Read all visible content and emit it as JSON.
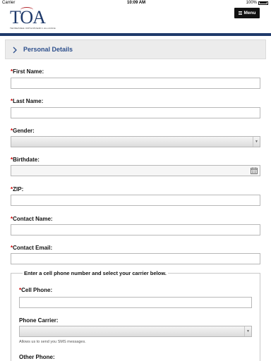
{
  "status_bar": {
    "carrier": "Carrier",
    "time": "10:09 AM",
    "battery": "100%"
  },
  "header": {
    "logo_text": "TOA",
    "logo_tagline": "TENNESSEE ORTHOPAEDIC ALLIANCE",
    "menu_label": "Menu"
  },
  "section": {
    "title": "Personal Details"
  },
  "form": {
    "required_mark": "*",
    "first_name": {
      "label": "First Name:",
      "value": ""
    },
    "last_name": {
      "label": "Last Name:",
      "value": ""
    },
    "gender": {
      "label": "Gender:",
      "value": ""
    },
    "birthdate": {
      "label": "Birthdate:",
      "value": ""
    },
    "zip": {
      "label": "ZIP:",
      "value": ""
    },
    "contact_name": {
      "label": "Contact Name:",
      "value": ""
    },
    "contact_email": {
      "label": "Contact Email:",
      "value": ""
    },
    "phone_group": {
      "legend": "Enter a cell phone number and select your carrier below.",
      "cell_phone": {
        "label": "Cell Phone:",
        "value": ""
      },
      "phone_carrier": {
        "label": "Phone Carrier:",
        "value": "",
        "help": "Allows us to send you SMS messages."
      },
      "other_phone": {
        "label": "Other Phone:"
      }
    }
  },
  "colors": {
    "brand_navy": "#1f3a6b",
    "brand_red": "#b3262c",
    "section_title": "#2d4f8c",
    "required": "#cc0000"
  }
}
